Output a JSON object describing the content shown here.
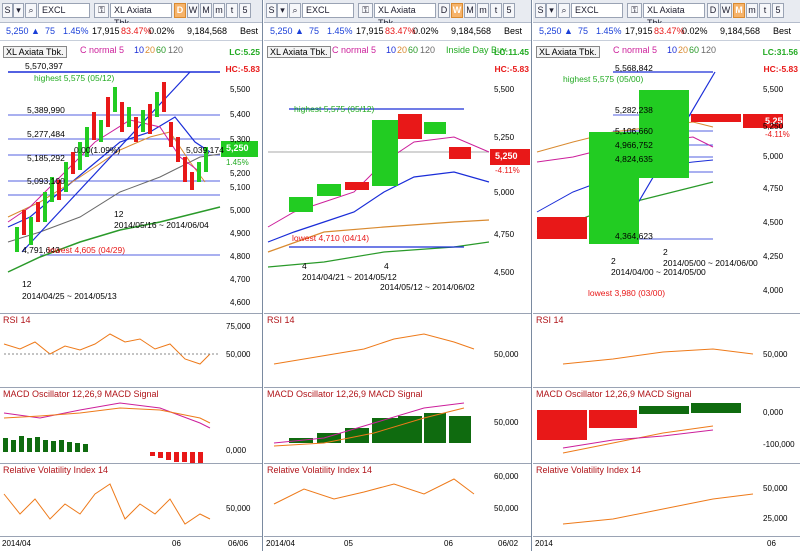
{
  "windows": [
    {
      "symbol": "EXCL",
      "name": "XL Axiata Tbk.",
      "period_buttons": [
        "D",
        "W",
        "M",
        "m",
        "t",
        "5"
      ],
      "active_period": "D",
      "quote": {
        "last": "5,250",
        "arrow": "▲",
        "change": "75",
        "pct": "1.45%",
        "volume": "17,915",
        "ratio": "83.47%",
        "ratio2": "0.02%",
        "value": "9,184,568",
        "best": "Best"
      },
      "title": "XL Axiata Tbk.",
      "indicators": {
        "normal": "C normal 5",
        "ma": [
          "10",
          "20",
          "60",
          "120"
        ]
      },
      "lc": "LC:5.25",
      "hc": "HC:-5.83",
      "badge_price": "5,250",
      "badge_pct": "1.45%",
      "price_labels": [
        "5,570,397",
        "highest 5,575 (05/12)",
        "5,389,990",
        "5,277,484",
        "0.00(1.09%)",
        "5,185,292",
        "5,093,100",
        "5,039,174",
        "4,791,643",
        "lowest 4,605 (04/29)",
        "12",
        "2014/04/25 ~ 2014/05/13",
        "12",
        "2014/05/16 ~ 2014/06/04"
      ],
      "y_ticks": [
        "5,500",
        "5,400",
        "5,300",
        "5,200",
        "5,100",
        "5,000",
        "4,900",
        "4,800",
        "4,700",
        "4,600"
      ],
      "rsi_title": "RSI 14",
      "rsi_ticks": [
        "75,000",
        "50,000"
      ],
      "macd_title": "MACD Oscillator 12,26,9  MACD  Signal",
      "macd_ticks": [
        "0,000"
      ],
      "rvi_title": "Relative Volatility Index 14",
      "rvi_ticks": [
        "50,000"
      ],
      "dates": [
        "2014/04",
        "06",
        "06/06"
      ]
    },
    {
      "symbol": "EXCL",
      "name": "XL Axiata Tbk.",
      "period_buttons": [
        "D",
        "W",
        "M",
        "m",
        "t",
        "5"
      ],
      "active_period": "W",
      "quote": {
        "last": "5,250",
        "arrow": "▲",
        "change": "75",
        "pct": "1.45%",
        "volume": "17,915",
        "ratio": "83.47%",
        "ratio2": "0.02%",
        "value": "9,184,568",
        "best": "Best"
      },
      "title": "XL Axiata Tbk.",
      "indicators": {
        "normal": "C normal 5",
        "ma": [
          "10",
          "20",
          "60",
          "120"
        ],
        "extra": "Inside Day Buy"
      },
      "lc": "LC:11.45",
      "hc": "HC:-5.83",
      "badge_price": "5,250",
      "badge_pct": "-4.11%",
      "price_labels": [
        "highest 5,575 (05/12)",
        "lowest 4,710 (04/14)",
        "4",
        "2014/04/21 ~ 2014/05/12",
        "4",
        "2014/05/12 ~ 2014/06/02"
      ],
      "y_ticks": [
        "5,500",
        "5,250",
        "5,000",
        "4,750",
        "4,500"
      ],
      "rsi_title": "RSI 14",
      "rsi_ticks": [
        "50,000"
      ],
      "macd_title": "MACD Oscillator 12,26,9  MACD  Signal",
      "macd_ticks": [
        "50,000"
      ],
      "rvi_title": "Relative Volatility Index 14",
      "rvi_ticks": [
        "60,000",
        "50,000"
      ],
      "dates": [
        "2014/04",
        "05",
        "06",
        "06/02"
      ]
    },
    {
      "symbol": "EXCL",
      "name": "XL Axiata Tbk.",
      "period_buttons": [
        "D",
        "W",
        "M",
        "m",
        "t",
        "5"
      ],
      "active_period": "M",
      "quote": {
        "last": "5,250",
        "arrow": "▲",
        "change": "75",
        "pct": "1.45%",
        "volume": "17,915",
        "ratio": "83.47%",
        "ratio2": "0.02%",
        "value": "9,184,568",
        "best": "Best"
      },
      "title": "XL Axiata Tbk.",
      "indicators": {
        "normal": "C normal 5",
        "ma": [
          "10",
          "20",
          "60",
          "120"
        ]
      },
      "lc": "LC:31.56",
      "hc": "HC:-5.83",
      "badge_price": "5,250",
      "badge_pct": "-4.11%",
      "price_labels": [
        "5,568,842",
        "highest 5,575 (05/00)",
        "5,282,238",
        "5,106,660",
        "4,966,752",
        "4,824,635",
        "4,364,623",
        "2",
        "2014/04/00 ~ 2014/05/00",
        "2",
        "2014/05/00 ~ 2014/06/00",
        "lowest 3,980 (03/00)"
      ],
      "y_ticks": [
        "5,500",
        "5,250",
        "5,000",
        "4,750",
        "4,500",
        "4,250",
        "4,000"
      ],
      "rsi_title": "RSI 14",
      "rsi_ticks": [
        "50,000"
      ],
      "macd_title": "MACD Oscillator 12,26,9  MACD  Signal",
      "macd_ticks": [
        "0,000",
        "-100,000"
      ],
      "rvi_title": "Relative Volatility Index 14",
      "rvi_ticks": [
        "50,000",
        "25,000"
      ],
      "dates": [
        "2014",
        "06"
      ]
    }
  ],
  "colors": {
    "up": "#22cc22",
    "down": "#e81818",
    "accent": "#d98a30",
    "ma": "#1a2dd8"
  }
}
